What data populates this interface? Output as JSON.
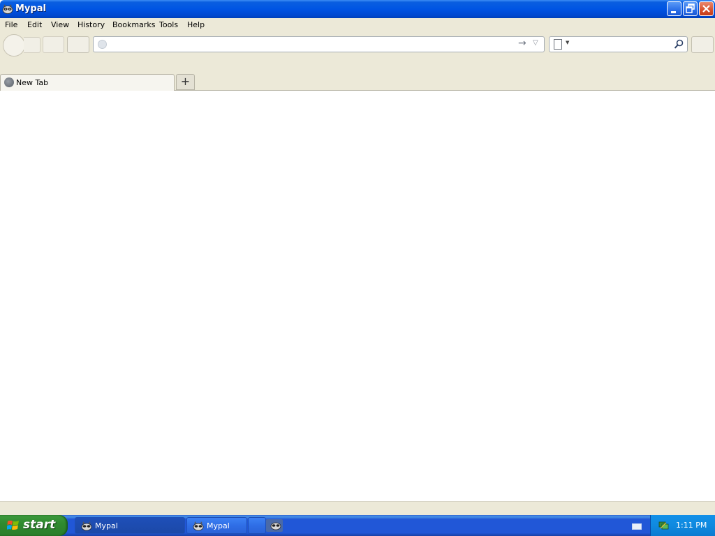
{
  "window": {
    "title": "Mypal",
    "controls": {
      "minimize": "minimize-icon",
      "restore": "restore-icon",
      "close": "close-icon"
    }
  },
  "menubar": {
    "items": [
      {
        "label": "File"
      },
      {
        "label": "Edit"
      },
      {
        "label": "View"
      },
      {
        "label": "History"
      },
      {
        "label": "Bookmarks"
      },
      {
        "label": "Tools"
      },
      {
        "label": "Help"
      }
    ]
  },
  "navbar": {
    "url_value": "",
    "search_value": ""
  },
  "tabs": [
    {
      "label": "New Tab",
      "selected": true
    }
  ],
  "taskbar": {
    "start_label": "start",
    "items": [
      {
        "label": "Mypal",
        "active": true
      },
      {
        "label": "Mypal",
        "active": false
      },
      {
        "label": "",
        "active": false
      }
    ],
    "clock": "1:11 PM"
  },
  "colors": {
    "titlebar_blue": "#0054e3",
    "chrome": "#ece9d8",
    "taskbar_blue": "#2157d7",
    "start_green": "#2f8a2f",
    "tray_blue": "#0f8ae0",
    "close_red": "#d8502c"
  }
}
